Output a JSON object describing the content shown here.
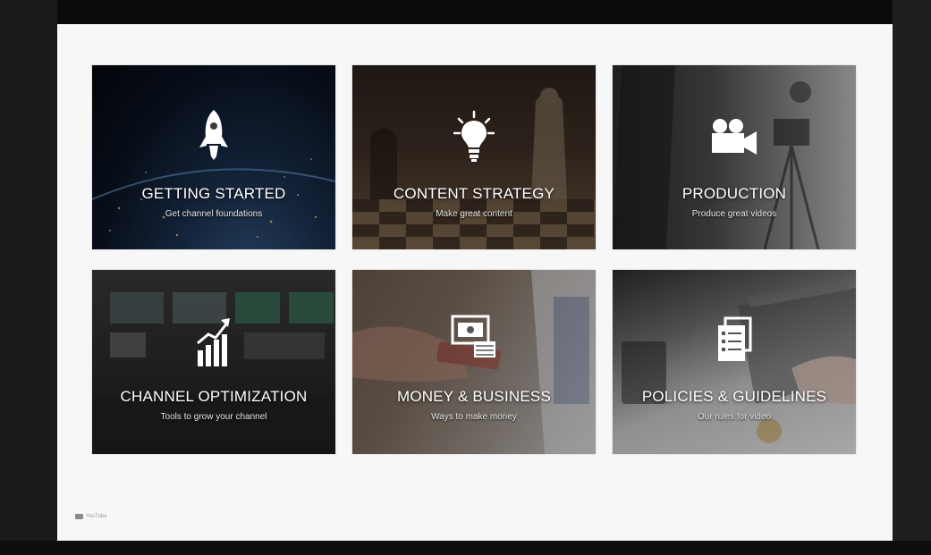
{
  "tiles": [
    {
      "title": "GETTING STARTED",
      "subtitle": "Get channel foundations",
      "icon": "rocket-icon"
    },
    {
      "title": "CONTENT STRATEGY",
      "subtitle": "Make great content",
      "icon": "lightbulb-icon"
    },
    {
      "title": "PRODUCTION",
      "subtitle": "Produce great videos",
      "icon": "video-camera-icon"
    },
    {
      "title": "CHANNEL OPTIMIZATION",
      "subtitle": "Tools to grow your channel",
      "icon": "growth-chart-icon"
    },
    {
      "title": "MONEY & BUSINESS",
      "subtitle": "Ways to make money",
      "icon": "money-screen-icon"
    },
    {
      "title": "POLICIES & GUIDELINES",
      "subtitle": "Our rules for video",
      "icon": "document-list-icon"
    }
  ],
  "footer": {
    "logo_text": "YouTube"
  },
  "colors": {
    "slide_bg": "#f7f7f7",
    "frame_bg": "#1b1b1b",
    "text": "#ffffff"
  }
}
